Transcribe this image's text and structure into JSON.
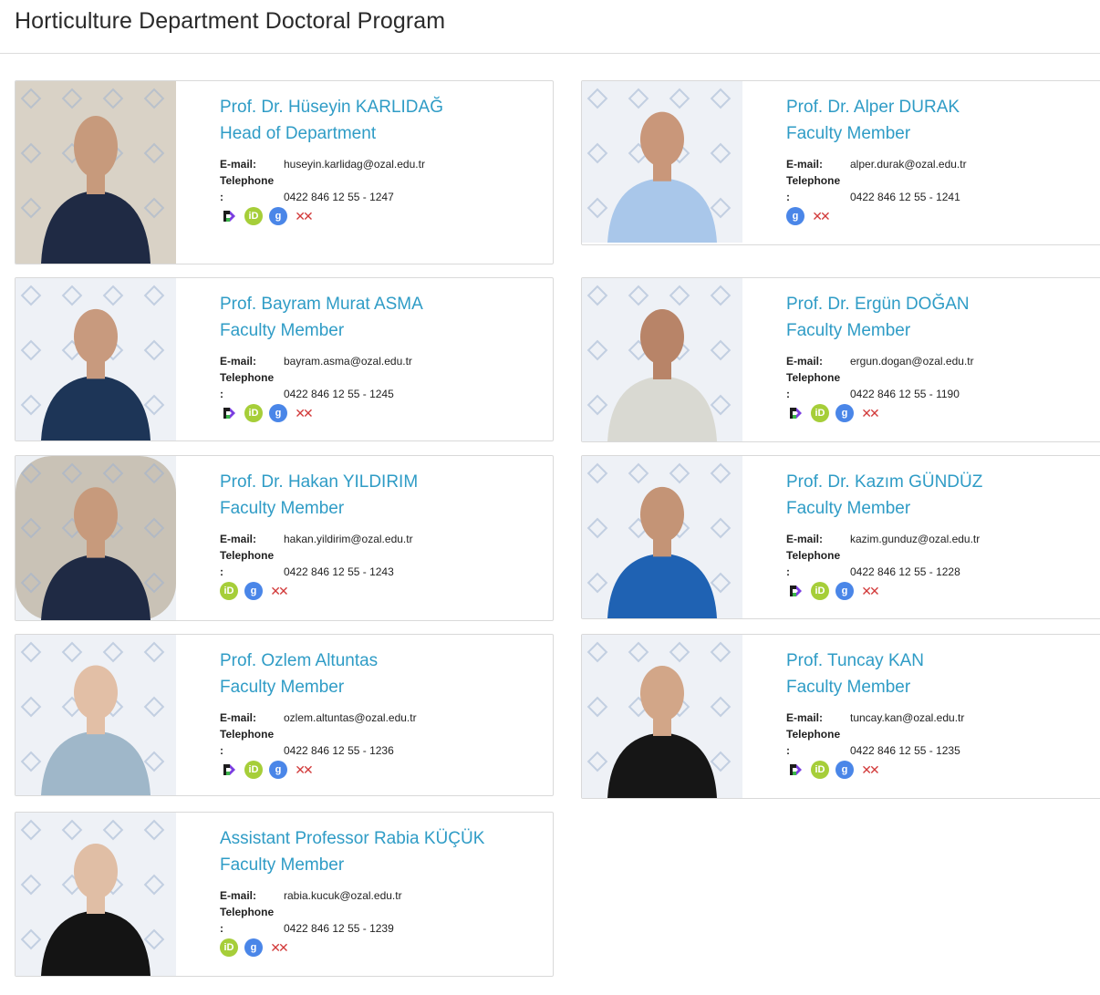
{
  "page": {
    "title": "Horticulture Department Doctoral Program"
  },
  "labels": {
    "email": "E-mail:",
    "telephone": "Telephone",
    "colon": ":"
  },
  "icons": {
    "publons": "publons-icon",
    "orcid": "orcid-icon",
    "scholar": "google-scholar-icon",
    "yok": "yok-academic-icon",
    "orcid_glyph": "iD",
    "scholar_glyph": "g",
    "yok_glyph": "✕✕",
    "colors": {
      "accent": "#2f9cc6",
      "orcid": "#a6ce39",
      "scholar": "#4a86e8",
      "yok": "#d23b3b"
    }
  },
  "members": [
    {
      "name": "Prof. Dr. Hüseyin KARLIDAĞ",
      "role": "Head of Department",
      "email": "huseyin.karlidag@ozal.edu.tr",
      "phone": "0422 846 12 55 - 1247",
      "links": [
        "publons",
        "orcid",
        "scholar",
        "yok"
      ]
    },
    {
      "name": "Prof. Dr. Alper DURAK",
      "role": "Faculty Member",
      "email": "alper.durak@ozal.edu.tr",
      "phone": "0422 846 12 55 - 1241",
      "links": [
        "scholar",
        "yok"
      ]
    },
    {
      "name": "Prof. Bayram Murat ASMA",
      "role": "Faculty Member",
      "email": "bayram.asma@ozal.edu.tr",
      "phone": "0422 846 12 55 - 1245",
      "links": [
        "publons",
        "orcid",
        "scholar",
        "yok"
      ]
    },
    {
      "name": "Prof. Dr. Ergün DOĞAN",
      "role": "Faculty Member",
      "email": "ergun.dogan@ozal.edu.tr",
      "phone": "0422 846 12 55 - 1190",
      "links": [
        "publons",
        "orcid",
        "scholar",
        "yok"
      ]
    },
    {
      "name": "Prof. Dr. Hakan YILDIRIM",
      "role": "Faculty Member",
      "email": "hakan.yildirim@ozal.edu.tr",
      "phone": "0422 846 12 55 - 1243",
      "links": [
        "orcid",
        "scholar",
        "yok"
      ]
    },
    {
      "name": "Prof. Dr. Kazım GÜNDÜZ",
      "role": "Faculty Member",
      "email": "kazim.gunduz@ozal.edu.tr",
      "phone": "0422 846 12 55 - 1228",
      "links": [
        "publons",
        "orcid",
        "scholar",
        "yok"
      ]
    },
    {
      "name": "Prof. Ozlem Altuntas",
      "role": "Faculty Member",
      "email": "ozlem.altuntas@ozal.edu.tr",
      "phone": "0422 846 12 55 - 1236",
      "links": [
        "publons",
        "orcid",
        "scholar",
        "yok"
      ]
    },
    {
      "name": "Prof. Tuncay KAN",
      "role": "Faculty Member",
      "email": "tuncay.kan@ozal.edu.tr",
      "phone": "0422 846 12 55 - 1235",
      "links": [
        "publons",
        "orcid",
        "scholar",
        "yok"
      ]
    },
    {
      "name": "Assistant Professor Rabia KÜÇÜK",
      "role": "Faculty Member",
      "email": "rabia.kucuk@ozal.edu.tr",
      "phone": "0422 846 12 55 - 1239",
      "links": [
        "orcid",
        "scholar",
        "yok"
      ]
    }
  ]
}
